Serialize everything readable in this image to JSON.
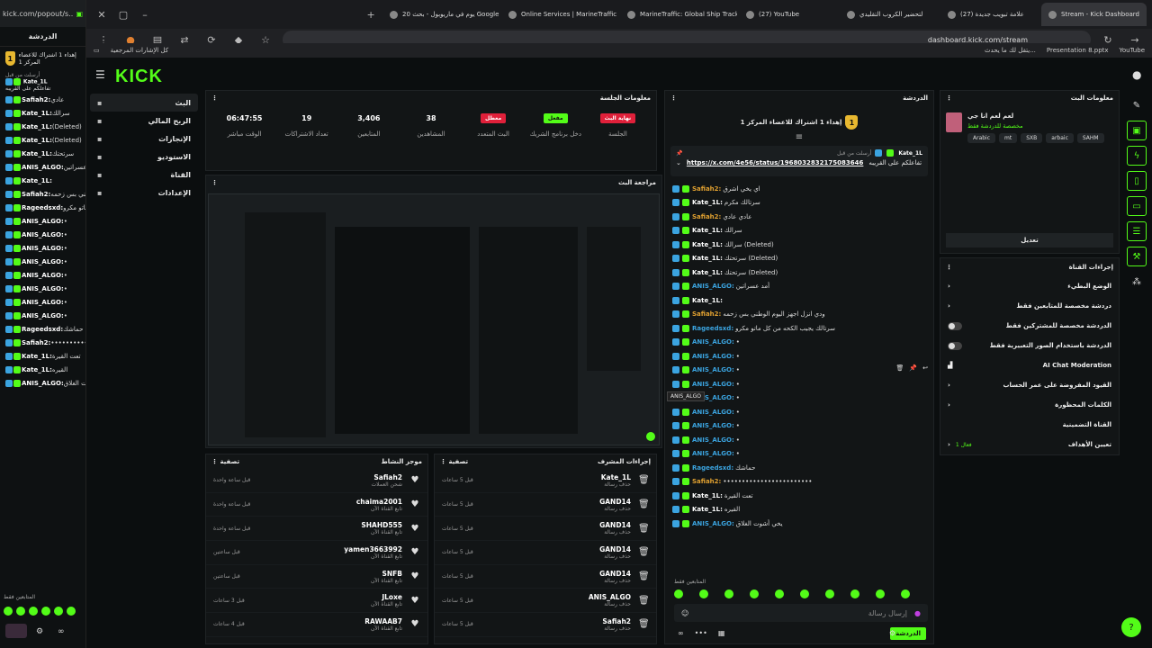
{
  "colors": {
    "accent": "#53fc18",
    "badge_blue": "#3ba4e0",
    "danger": "#e0203a",
    "gold": "#e8b830"
  },
  "popout": {
    "url": "kick.com/popout/s...",
    "title": "الدردشة",
    "pin_text": "إهداء 1 اشتراك للاعضاء المرکز 1",
    "pinned_by": "أرسلت من قبل",
    "pinned_user": "Kate_1L",
    "pinned_text": "تفاعلكم على القريبه",
    "messages": [
      {
        "user": "Safiah2:",
        "text": "عادي"
      },
      {
        "user": "Kate_1L:",
        "text": "سرالك"
      },
      {
        "user": "Kate_1L:",
        "text": "(Deleted)"
      },
      {
        "user": "Kate_1L:",
        "text": "(Deleted)"
      },
      {
        "user": "Kate_1L:",
        "text": "سرتحتك"
      },
      {
        "user": "ANIS_ALGO:",
        "text": "أمد عسراتين"
      },
      {
        "user": "Kate_1L:",
        "text": ""
      },
      {
        "user": "Safiah2:",
        "text": "ودي انزل اجهز اليوم الوطني بس زحمه"
      },
      {
        "user": "Rageedsxd:",
        "text": "سرتالك يجيب الكحه من كل ماتو مكرو"
      },
      {
        "user": "ANIS_ALGO:",
        "text": "•"
      },
      {
        "user": "ANIS_ALGO:",
        "text": "•"
      },
      {
        "user": "ANIS_ALGO:",
        "text": "•"
      },
      {
        "user": "ANIS_ALGO:",
        "text": "•"
      },
      {
        "user": "ANIS_ALGO:",
        "text": "•"
      },
      {
        "user": "ANIS_ALGO:",
        "text": "•"
      },
      {
        "user": "ANIS_ALGO:",
        "text": "•"
      },
      {
        "user": "ANIS_ALGO:",
        "text": "•"
      },
      {
        "user": "Rageedsxd:",
        "text": "حماشك"
      },
      {
        "user": "Safiah2:",
        "text": "••••••••••••••••••••••••"
      },
      {
        "user": "Kate_1L:",
        "text": "تعت القيرة"
      },
      {
        "user": "Kate_1L:",
        "text": "القيره"
      },
      {
        "user": "ANIS_ALGO:",
        "text": "يخي أشوت الغلاق"
      }
    ],
    "footer": "المتابعين فقط"
  },
  "tabs": [
    {
      "label": "Stream - Kick Dashboard",
      "active": true
    },
    {
      "label": "(27) علامة تبويب جديدة",
      "active": false
    },
    {
      "label": "لتحضير الكروب التقليدي",
      "active": false
    },
    {
      "label": "(27) YouTube",
      "active": false
    },
    {
      "label": "MarineTraffic: Global Ship Tracking",
      "active": false
    },
    {
      "label": "Online Services | MarineTraffic",
      "active": false
    },
    {
      "label": "20 يوم في ماريوبول - بحث Google",
      "active": false
    }
  ],
  "address": "dashboard.kick.com/stream",
  "bookmarks": {
    "all": "كل الإشارات المرجعية",
    "items": [
      "YouTube",
      "Presentation 8.pptx",
      "يتقل لك ما يحدث..."
    ]
  },
  "nav": [
    {
      "label": "البث",
      "icon": "play-icon"
    },
    {
      "label": "الربح المالي",
      "icon": "dollar-icon"
    },
    {
      "label": "الإنجازات",
      "icon": "trophy-icon"
    },
    {
      "label": "الاستوديو",
      "icon": "studio-icon"
    },
    {
      "label": "القناة",
      "icon": "channel-icon"
    },
    {
      "label": "الإعدادات",
      "icon": "gear-icon"
    }
  ],
  "session": {
    "title": "معلومات الجلسة",
    "stats": [
      {
        "value": "06:47:55",
        "label": "الوقت مباشر"
      },
      {
        "value": "19",
        "label": "تعداد الاشتراكات"
      },
      {
        "value": "3,406",
        "label": "المتابعين"
      },
      {
        "value": "38",
        "label": "المشاهدين"
      },
      {
        "pill": "معطل",
        "pill_color": "red",
        "label": "البث المتعدد"
      },
      {
        "pill": "مفعل",
        "pill_color": "green",
        "label": "دخل برنامج الشريك"
      },
      {
        "pill": "نهاية البث",
        "pill_color": "red",
        "label": "الجلسة"
      }
    ]
  },
  "preview": {
    "title": "مراجعة البث"
  },
  "activity": {
    "title": "موجز النشاط",
    "filter": "تصفية",
    "rows": [
      {
        "name": "Safiah2",
        "sub": "شحن العملات",
        "time": "قبل ساعة واحدة"
      },
      {
        "name": "chaima2001",
        "sub": "تابع القناة الآن",
        "time": "قبل ساعة واحدة"
      },
      {
        "name": "SHAHD555",
        "sub": "تابع القناة الآن",
        "time": "قبل ساعة واحدة"
      },
      {
        "name": "yamen3663992",
        "sub": "تابع القناة الآن",
        "time": "قبل ساعتين"
      },
      {
        "name": "SNFB",
        "sub": "تابع القناة الآن",
        "time": "قبل ساعتين"
      },
      {
        "name": "JLoxe",
        "sub": "تابع القناة الآن",
        "time": "قبل 3 ساعات"
      },
      {
        "name": "RAWAAB7",
        "sub": "تابع القناة الآن",
        "time": "قبل 4 ساعات"
      }
    ]
  },
  "modactions": {
    "title": "إجراءات المشرف",
    "filter": "تصفية",
    "rows": [
      {
        "name": "Kate_1L",
        "sub": "حذف رسالة",
        "time": "قبل 5 ساعات"
      },
      {
        "name": "GAND14",
        "sub": "حذف رسالة",
        "time": "قبل 5 ساعات"
      },
      {
        "name": "GAND14",
        "sub": "حذف رسالة",
        "time": "قبل 5 ساعات"
      },
      {
        "name": "GAND14",
        "sub": "حذف رسالة",
        "time": "قبل 5 ساعات"
      },
      {
        "name": "GAND14",
        "sub": "حذف رسالة",
        "time": "قبل 5 ساعات"
      },
      {
        "name": "ANIS_ALGO",
        "sub": "حذف رسالة",
        "time": "قبل 5 ساعات"
      },
      {
        "name": "Safiah2",
        "sub": "حذف رسالة",
        "time": "قبل 5 ساعات"
      }
    ]
  },
  "chat": {
    "title": "الدردشة",
    "pin_banner": "إهداء 1 اشتراك للاعضاء المرکز 1",
    "pinned_user": "Kate_1L",
    "pinned_by": "أرسلت من قبل",
    "pinned_link": "https://x.com/4e56/status/1968032832175083646",
    "pinned_text": "تفاعلكم على القريبه",
    "messages": [
      {
        "user": "Safiah2:",
        "text": "اي يخي اشرق",
        "color": "#e0a030"
      },
      {
        "user": "Kate_1L:",
        "text": "سرتالك مكرم",
        "color": "#ffffff"
      },
      {
        "user": "Safiah2:",
        "text": "عادي عادي",
        "color": "#e0a030"
      },
      {
        "user": "Kate_1L:",
        "text": "سرالك",
        "color": "#ffffff"
      },
      {
        "user": "Kate_1L:",
        "text": "سرالك (Deleted)",
        "color": "#ffffff"
      },
      {
        "user": "Kate_1L:",
        "text": "سرتحتك (Deleted)",
        "color": "#ffffff"
      },
      {
        "user": "Kate_1L:",
        "text": "سرتحتك (Deleted)",
        "color": "#ffffff"
      },
      {
        "user": "ANIS_ALGO:",
        "text": "أمد عسراتين",
        "color": "#3ba4e0"
      },
      {
        "user": "Kate_1L:",
        "text": "",
        "color": "#ffffff"
      },
      {
        "user": "Safiah2:",
        "text": "ودي انزل اجهز اليوم الوطني بس زحمه",
        "color": "#e0a030"
      },
      {
        "user": "Rageedsxd:",
        "text": "سرتالك يجيب الكحه من كل ماتو مكرو",
        "color": "#3ba4e0"
      },
      {
        "user": "ANIS_ALGO:",
        "text": "•",
        "color": "#3ba4e0"
      },
      {
        "user": "ANIS_ALGO:",
        "text": "•",
        "color": "#3ba4e0"
      },
      {
        "user": "ANIS_ALGO:",
        "text": "•",
        "color": "#3ba4e0"
      },
      {
        "user": "ANIS_ALGO:",
        "text": "•",
        "color": "#3ba4e0"
      },
      {
        "user": "ANIS_ALGO:",
        "text": "•",
        "color": "#3ba4e0"
      },
      {
        "user": "ANIS_ALGO:",
        "text": "•",
        "color": "#3ba4e0"
      },
      {
        "user": "ANIS_ALGO:",
        "text": "•",
        "color": "#3ba4e0"
      },
      {
        "user": "ANIS_ALGO:",
        "text": "•",
        "color": "#3ba4e0"
      },
      {
        "user": "ANIS_ALGO:",
        "text": "•",
        "color": "#3ba4e0"
      },
      {
        "user": "Rageedsxd:",
        "text": "حماشك",
        "color": "#3ba4e0"
      },
      {
        "user": "Safiah2:",
        "text": "••••••••••••••••••••••••",
        "color": "#e0a030"
      },
      {
        "user": "Kate_1L:",
        "text": "تعت القيرة",
        "color": "#ffffff"
      },
      {
        "user": "Kate_1L:",
        "text": "القيره",
        "color": "#ffffff"
      },
      {
        "user": "ANIS_ALGO:",
        "text": "يخي أشوت الغلاق",
        "color": "#3ba4e0"
      }
    ],
    "tooltip": "ANIS_ALGO",
    "followers_only": "المتابعين فقط",
    "input_placeholder": "إرسال رسالة",
    "send_label": "الدردشة"
  },
  "streaminfo": {
    "title": "معلومات البث",
    "stream_title": "لعم لعم انا جي",
    "category": "مخصصة للدردشة فقط",
    "tags": [
      "Arabic",
      "mt",
      "SXB",
      "arbaic",
      "SAHM"
    ],
    "edit": "تعديل"
  },
  "channel_actions": {
    "title": "إجراءات القناة",
    "items": [
      {
        "label": "الوضع البطيء",
        "control": "chevron"
      },
      {
        "label": "دردشة مخصصة للمتابعين فقط",
        "control": "chevron"
      },
      {
        "label": "الدردشة مخصصة للمشتركين فقط",
        "control": "toggle"
      },
      {
        "label": "الدردشة باستخدام الصور التعبيرية فقط",
        "control": "toggle"
      },
      {
        "label": "AI Chat Moderation",
        "control": "icon"
      },
      {
        "label": "القيود المفروضة على عمر الحساب",
        "control": "chevron"
      },
      {
        "label": "الكلمات المحظورة",
        "control": "chevron"
      },
      {
        "label": "القناة التضمينية",
        "control": "none"
      },
      {
        "label": "تعيين الأهداف",
        "control": "chevron"
      }
    ],
    "goal_badge": "فعال 1"
  }
}
